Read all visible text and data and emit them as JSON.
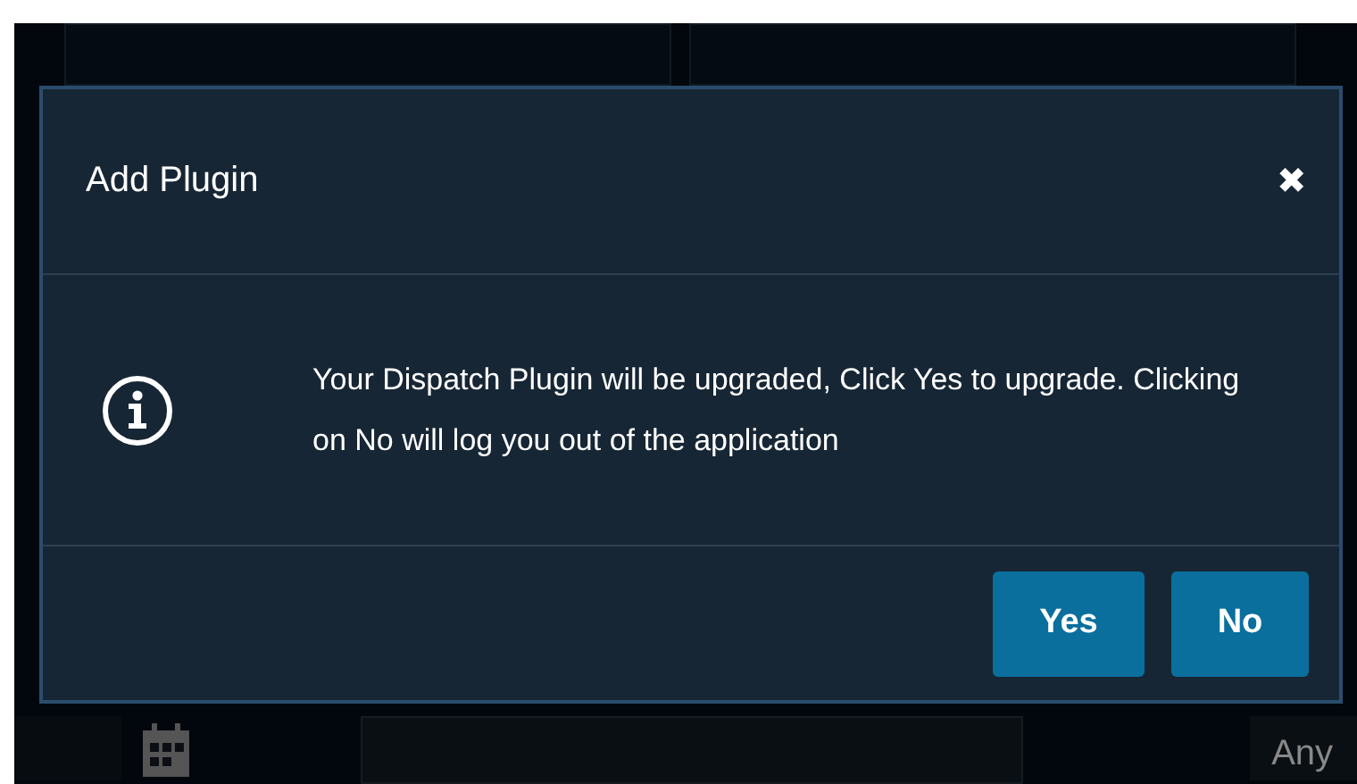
{
  "dialog": {
    "title": "Add Plugin",
    "close": "✖",
    "message": "Your Dispatch Plugin will be upgraded, Click Yes to upgrade. Clicking on No will log you out of the application",
    "buttons": [
      "Yes",
      "No"
    ]
  },
  "background": {
    "filter_value": "Any"
  }
}
